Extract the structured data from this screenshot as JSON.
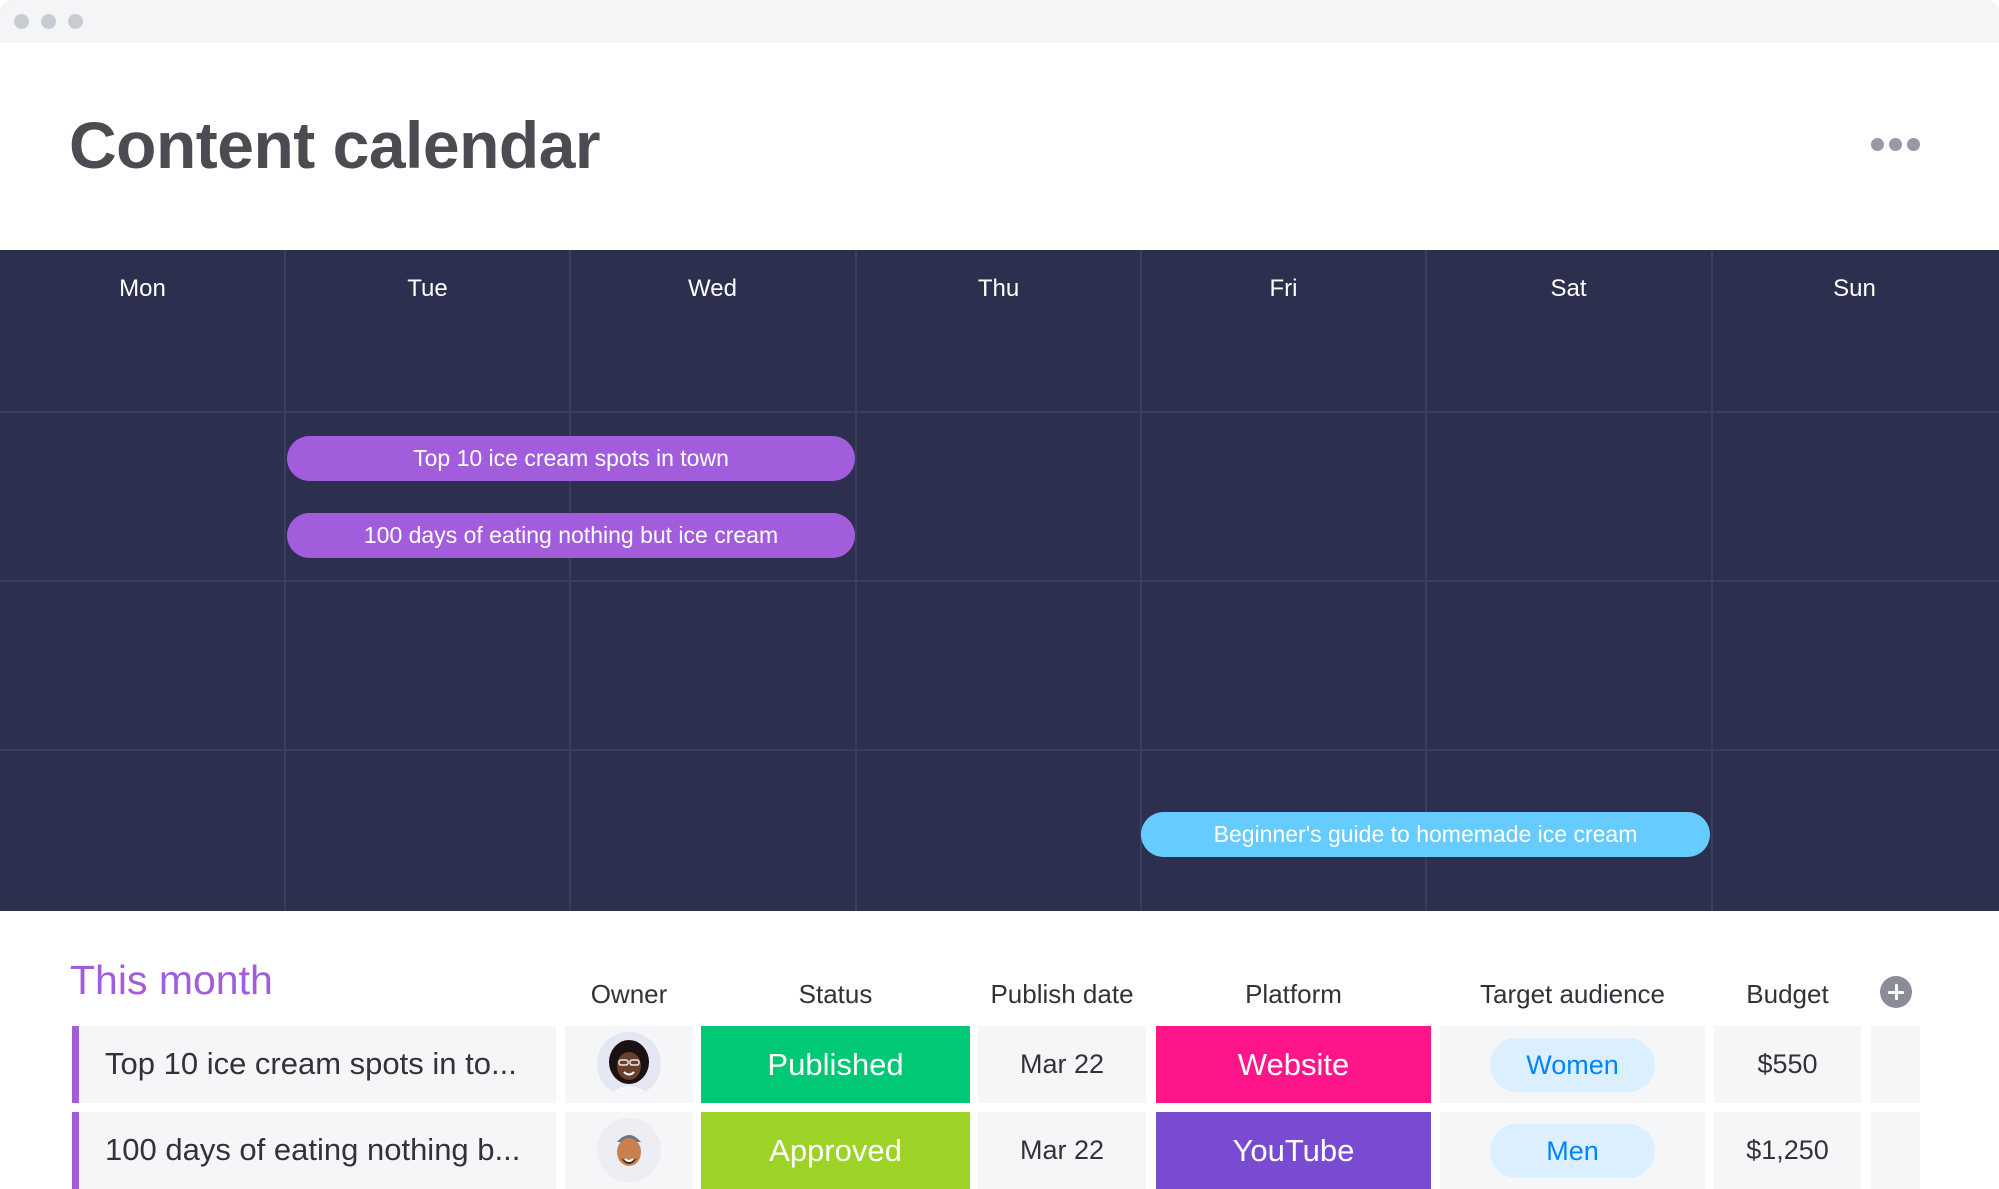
{
  "window": {
    "controls": [
      "window-dot",
      "window-dot",
      "window-dot"
    ]
  },
  "header": {
    "title": "Content calendar",
    "more_icon": "more-horizontal-icon"
  },
  "calendar": {
    "days": [
      "Mon",
      "Tue",
      "Wed",
      "Thu",
      "Fri",
      "Sat",
      "Sun"
    ],
    "weeks": 4,
    "events": [
      {
        "title": "Top 10 ice cream spots in town",
        "week": 2,
        "start_day": "Tue",
        "end_day": "Wed",
        "color": "#a25ddc"
      },
      {
        "title": "100 days of eating nothing but ice cream",
        "week": 2,
        "start_day": "Tue",
        "end_day": "Wed",
        "color": "#a25ddc"
      },
      {
        "title": "Beginner's guide to homemade ice cream",
        "week": 4,
        "start_day": "Fri",
        "end_day": "Sat",
        "color": "#66ccff"
      }
    ]
  },
  "table": {
    "group_title": "This month",
    "group_color": "#a25ddc",
    "columns": {
      "owner": "Owner",
      "status": "Status",
      "publish_date": "Publish date",
      "platform": "Platform",
      "target_audience": "Target audience",
      "budget": "Budget"
    },
    "add_column_icon": "plus-circle-icon",
    "rows": [
      {
        "item": "Top 10 ice cream spots in to...",
        "owner_avatar": "avatar-woman-glasses",
        "status": "Published",
        "status_color": "#00c875",
        "publish_date": "Mar 22",
        "platform": "Website",
        "platform_color": "#ff158a",
        "target_audience": "Women",
        "budget": "$550"
      },
      {
        "item": "100 days of eating nothing b...",
        "owner_avatar": "avatar-man-cap",
        "status": "Approved",
        "status_color": "#9cd326",
        "publish_date": "Mar 22",
        "platform": "YouTube",
        "platform_color": "#784bd1",
        "target_audience": "Men",
        "budget": "$1,250"
      }
    ]
  }
}
